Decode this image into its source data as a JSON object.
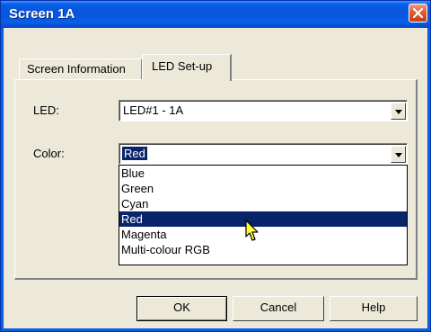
{
  "window": {
    "title": "Screen 1A"
  },
  "tabs": [
    {
      "label": "Screen Information",
      "active": false
    },
    {
      "label": "LED Set-up",
      "active": true
    }
  ],
  "led_field": {
    "label": "LED:",
    "value": "LED#1 - 1A"
  },
  "color_field": {
    "label": "Color:",
    "value": "Red"
  },
  "color_options": [
    "Blue",
    "Green",
    "Cyan",
    "Red",
    "Magenta",
    "Multi-colour RGB"
  ],
  "color_options_highlighted": "Red",
  "buttons": {
    "ok": "OK",
    "cancel": "Cancel",
    "help": "Help"
  },
  "colors": {
    "titlebar": "#0a5ee8",
    "selection": "#0a246a",
    "close_button": "#e05a33",
    "dialog_bg": "#ece9d8"
  }
}
